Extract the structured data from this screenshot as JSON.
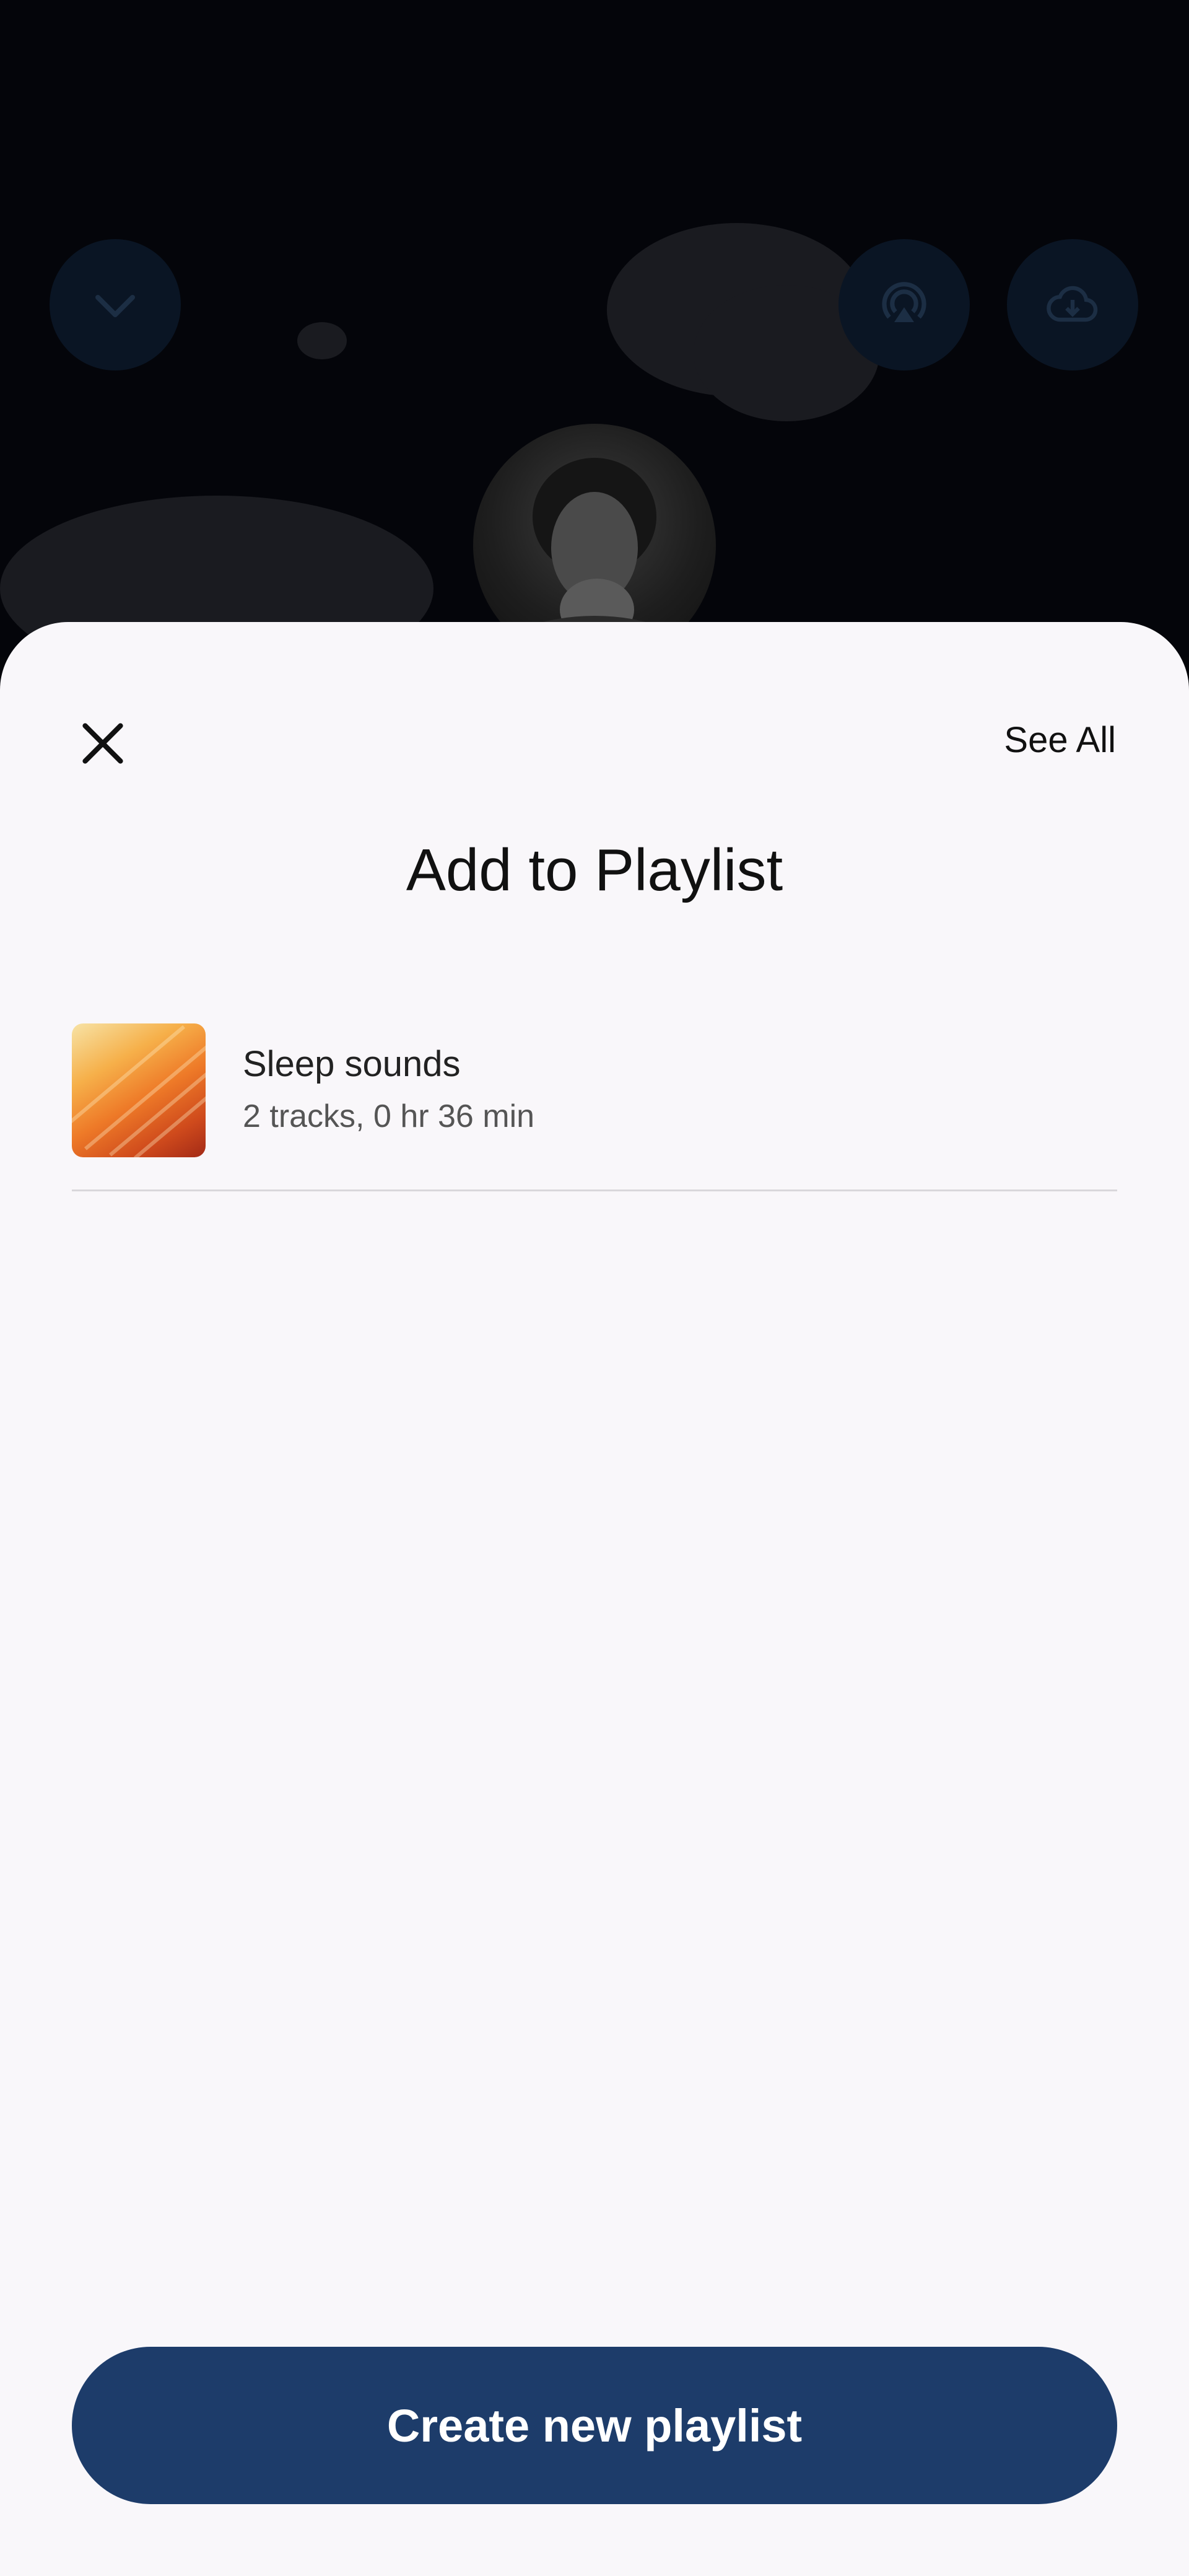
{
  "player_controls": {
    "collapse_icon": "chevron-down-icon",
    "cast_icon": "cast-icon",
    "download_icon": "cloud-download-icon"
  },
  "sheet": {
    "see_all_label": "See All",
    "title": "Add to Playlist",
    "close_icon": "close-icon",
    "playlists": [
      {
        "name": "Sleep sounds",
        "meta": "2 tracks, 0 hr 36 min"
      }
    ],
    "create_button_label": "Create new playlist"
  },
  "colors": {
    "accent": "#1d3c6a",
    "sheet_background": "#f9f7fa",
    "backdrop": "#05060a"
  }
}
